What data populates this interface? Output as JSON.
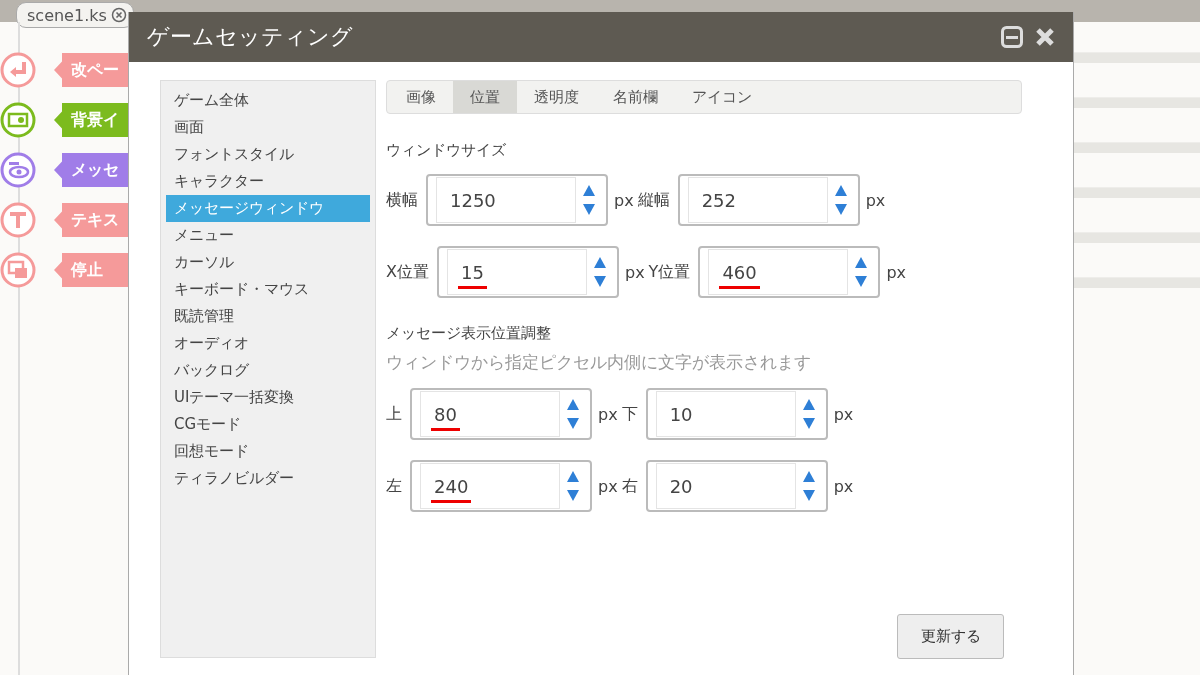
{
  "editor_tab": {
    "label": "scene1.ks"
  },
  "palette": [
    {
      "label": "改ペー",
      "color": "#f59a9a",
      "kind": "return"
    },
    {
      "label": "背景イ",
      "color": "#7cbb1e",
      "kind": "picture"
    },
    {
      "label": "メッセ",
      "color": "#a07de8",
      "kind": "eye"
    },
    {
      "label": "テキス",
      "color": "#f59a9a",
      "kind": "letter"
    },
    {
      "label": "停止",
      "color": "#f59a9a",
      "kind": "windows"
    }
  ],
  "dialog": {
    "title": "ゲームセッティング",
    "sidebar": {
      "items": [
        {
          "label": "ゲーム全体",
          "selected": false
        },
        {
          "label": "画面",
          "selected": false
        },
        {
          "label": "フォントスタイル",
          "selected": false
        },
        {
          "label": "キャラクター",
          "selected": false
        },
        {
          "label": "メッセージウィンドウ",
          "selected": true
        },
        {
          "label": "メニュー",
          "selected": false
        },
        {
          "label": "カーソル",
          "selected": false
        },
        {
          "label": "キーボード・マウス",
          "selected": false
        },
        {
          "label": "既読管理",
          "selected": false
        },
        {
          "label": "オーディオ",
          "selected": false
        },
        {
          "label": "バックログ",
          "selected": false
        },
        {
          "label": "UIテーマ一括変換",
          "selected": false
        },
        {
          "label": "CGモード",
          "selected": false
        },
        {
          "label": "回想モード",
          "selected": false
        },
        {
          "label": "ティラノビルダー",
          "selected": false
        }
      ]
    },
    "tabs": [
      {
        "label": "画像",
        "selected": false
      },
      {
        "label": "位置",
        "selected": true
      },
      {
        "label": "透明度",
        "selected": false
      },
      {
        "label": "名前欄",
        "selected": false
      },
      {
        "label": "アイコン",
        "selected": false
      }
    ],
    "sections": [
      {
        "heading": "ウィンドウサイズ",
        "rows": [
          [
            {
              "label": "横幅",
              "value": "1250",
              "unit": "px",
              "underlined": false
            },
            {
              "label": "縦幅",
              "value": "252",
              "unit": "px",
              "underlined": false
            }
          ],
          [
            {
              "label": "X位置",
              "value": "15",
              "unit": "px",
              "underlined": true
            },
            {
              "label": "Y位置",
              "value": "460",
              "unit": "px",
              "underlined": true
            }
          ]
        ]
      },
      {
        "heading": "メッセージ表示位置調整",
        "hint": "ウィンドウから指定ピクセル内側に文字が表示されます",
        "rows": [
          [
            {
              "label": "上",
              "value": "80",
              "unit": "px",
              "underlined": true
            },
            {
              "label": "下",
              "value": "10",
              "unit": "px",
              "underlined": false
            }
          ],
          [
            {
              "label": "左",
              "value": "240",
              "unit": "px",
              "underlined": true
            },
            {
              "label": "右",
              "value": "20",
              "unit": "px",
              "underlined": false
            }
          ]
        ]
      }
    ],
    "update_button": "更新する"
  }
}
